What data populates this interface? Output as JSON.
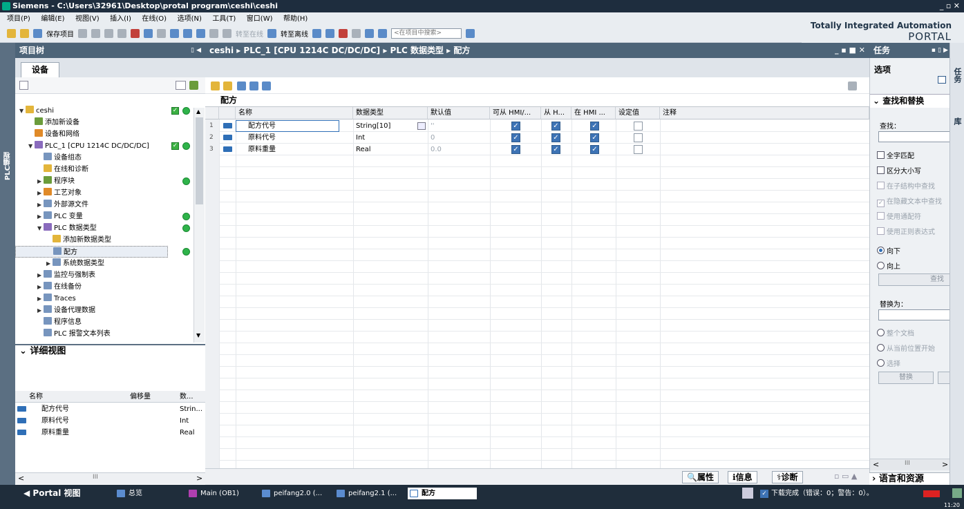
{
  "app": {
    "title": "Siemens - C:\\Users\\32961\\Desktop\\protal program\\ceshi\\ceshi",
    "window_controls": "_ ▫ ✕"
  },
  "menu": [
    "项目(P)",
    "编辑(E)",
    "视图(V)",
    "插入(I)",
    "在线(O)",
    "选项(N)",
    "工具(T)",
    "窗口(W)",
    "帮助(H)"
  ],
  "toolbar": {
    "save": "保存项目",
    "go_online": "转至在线",
    "go_offline": "转至离线",
    "search_placeholder": "<在项目中搜索>"
  },
  "brand": {
    "line1": "Totally Integrated Automation",
    "line2": "PORTAL"
  },
  "left_strip": "PLC编程",
  "project_tree": {
    "title": "项目树",
    "tab": "设备",
    "items": [
      {
        "label": "ceshi",
        "indent": 0,
        "arrow": "▼",
        "status": "check-dot"
      },
      {
        "label": "添加新设备",
        "indent": 1,
        "arrow": ""
      },
      {
        "label": "设备和网络",
        "indent": 1,
        "arrow": ""
      },
      {
        "label": "PLC_1 [CPU 1214C DC/DC/DC]",
        "indent": 1,
        "arrow": "▼",
        "status": "check-dot"
      },
      {
        "label": "设备组态",
        "indent": 2,
        "arrow": ""
      },
      {
        "label": "在线和诊断",
        "indent": 2,
        "arrow": ""
      },
      {
        "label": "程序块",
        "indent": 2,
        "arrow": "▶",
        "status": "dot"
      },
      {
        "label": "工艺对象",
        "indent": 2,
        "arrow": "▶"
      },
      {
        "label": "外部源文件",
        "indent": 2,
        "arrow": "▶"
      },
      {
        "label": "PLC 变量",
        "indent": 2,
        "arrow": "▶",
        "status": "dot"
      },
      {
        "label": "PLC 数据类型",
        "indent": 2,
        "arrow": "▼",
        "status": "dot"
      },
      {
        "label": "添加新数据类型",
        "indent": 3,
        "arrow": ""
      },
      {
        "label": "配方",
        "indent": 3,
        "arrow": "",
        "status": "dot",
        "selected": true
      },
      {
        "label": "系统数据类型",
        "indent": 3,
        "arrow": "▶"
      },
      {
        "label": "监控与强制表",
        "indent": 2,
        "arrow": "▶"
      },
      {
        "label": "在线备份",
        "indent": 2,
        "arrow": "▶"
      },
      {
        "label": "Traces",
        "indent": 2,
        "arrow": "▶"
      },
      {
        "label": "设备代理数据",
        "indent": 2,
        "arrow": "▶"
      },
      {
        "label": "程序信息",
        "indent": 2,
        "arrow": ""
      },
      {
        "label": "PLC 报警文本列表",
        "indent": 2,
        "arrow": ""
      }
    ]
  },
  "detail_view": {
    "title": "详细视图",
    "columns": [
      "名称",
      "偏移量",
      "数..."
    ],
    "rows": [
      {
        "name": "配方代号",
        "offset": "",
        "type": "Strin..."
      },
      {
        "name": "原料代号",
        "offset": "",
        "type": "Int"
      },
      {
        "name": "原料重量",
        "offset": "",
        "type": "Real"
      }
    ],
    "scroll_mark": "III"
  },
  "editor": {
    "breadcrumb": "ceshi ▸ PLC_1 [CPU 1214C DC/DC/DC] ▸ PLC 数据类型 ▸ 配方",
    "window_controls": "_ ▪ ■ ✕",
    "title": "配方",
    "columns": [
      "名称",
      "数据类型",
      "默认值",
      "可从 HMI/...",
      "从 H...",
      "在 HMI ...",
      "设定值",
      "注释"
    ],
    "rows": [
      {
        "num": "1",
        "name": "配方代号",
        "type": "String[10]",
        "default": "''",
        "hmi_access": true,
        "hmi_write": true,
        "hmi_visible": true,
        "setpoint": false,
        "comment": ""
      },
      {
        "num": "2",
        "name": "原料代号",
        "type": "Int",
        "default": "0",
        "hmi_access": true,
        "hmi_write": true,
        "hmi_visible": true,
        "setpoint": false,
        "comment": ""
      },
      {
        "num": "3",
        "name": "原料重量",
        "type": "Real",
        "default": "0.0",
        "hmi_access": true,
        "hmi_write": true,
        "hmi_visible": true,
        "setpoint": false,
        "comment": ""
      }
    ],
    "bottom_tabs": [
      "属性",
      "信息",
      "诊断"
    ]
  },
  "tasks": {
    "title": "任务",
    "options": "选项",
    "find_replace": "查找和替换",
    "find_label": "查找：",
    "checks": [
      "全字匹配",
      "区分大小写",
      "在子结构中查找",
      "在隐藏文本中查找",
      "使用通配符",
      "使用正则表达式"
    ],
    "checks_state": [
      false,
      false,
      false,
      true,
      false,
      false
    ],
    "checks_enabled": [
      true,
      true,
      false,
      false,
      false,
      false
    ],
    "dir": [
      "向下",
      "向上"
    ],
    "find_btn": "查找",
    "replace_label": "替换为：",
    "scope": [
      "整个文档",
      "从当前位置开始",
      "选择"
    ],
    "replace_btn": "替换",
    "lang": "语言和资源",
    "scroll_mark": "III"
  },
  "right_strip": [
    "任务",
    "库"
  ],
  "statusbar": {
    "portal": "Portal 视图",
    "tabs": [
      "总览",
      "Main (OB1)",
      "peifang2.0 (...",
      "peifang2.1 (...",
      "配方"
    ],
    "status": "下载完成（错误：0；警告：0）。",
    "time": "11:20"
  }
}
